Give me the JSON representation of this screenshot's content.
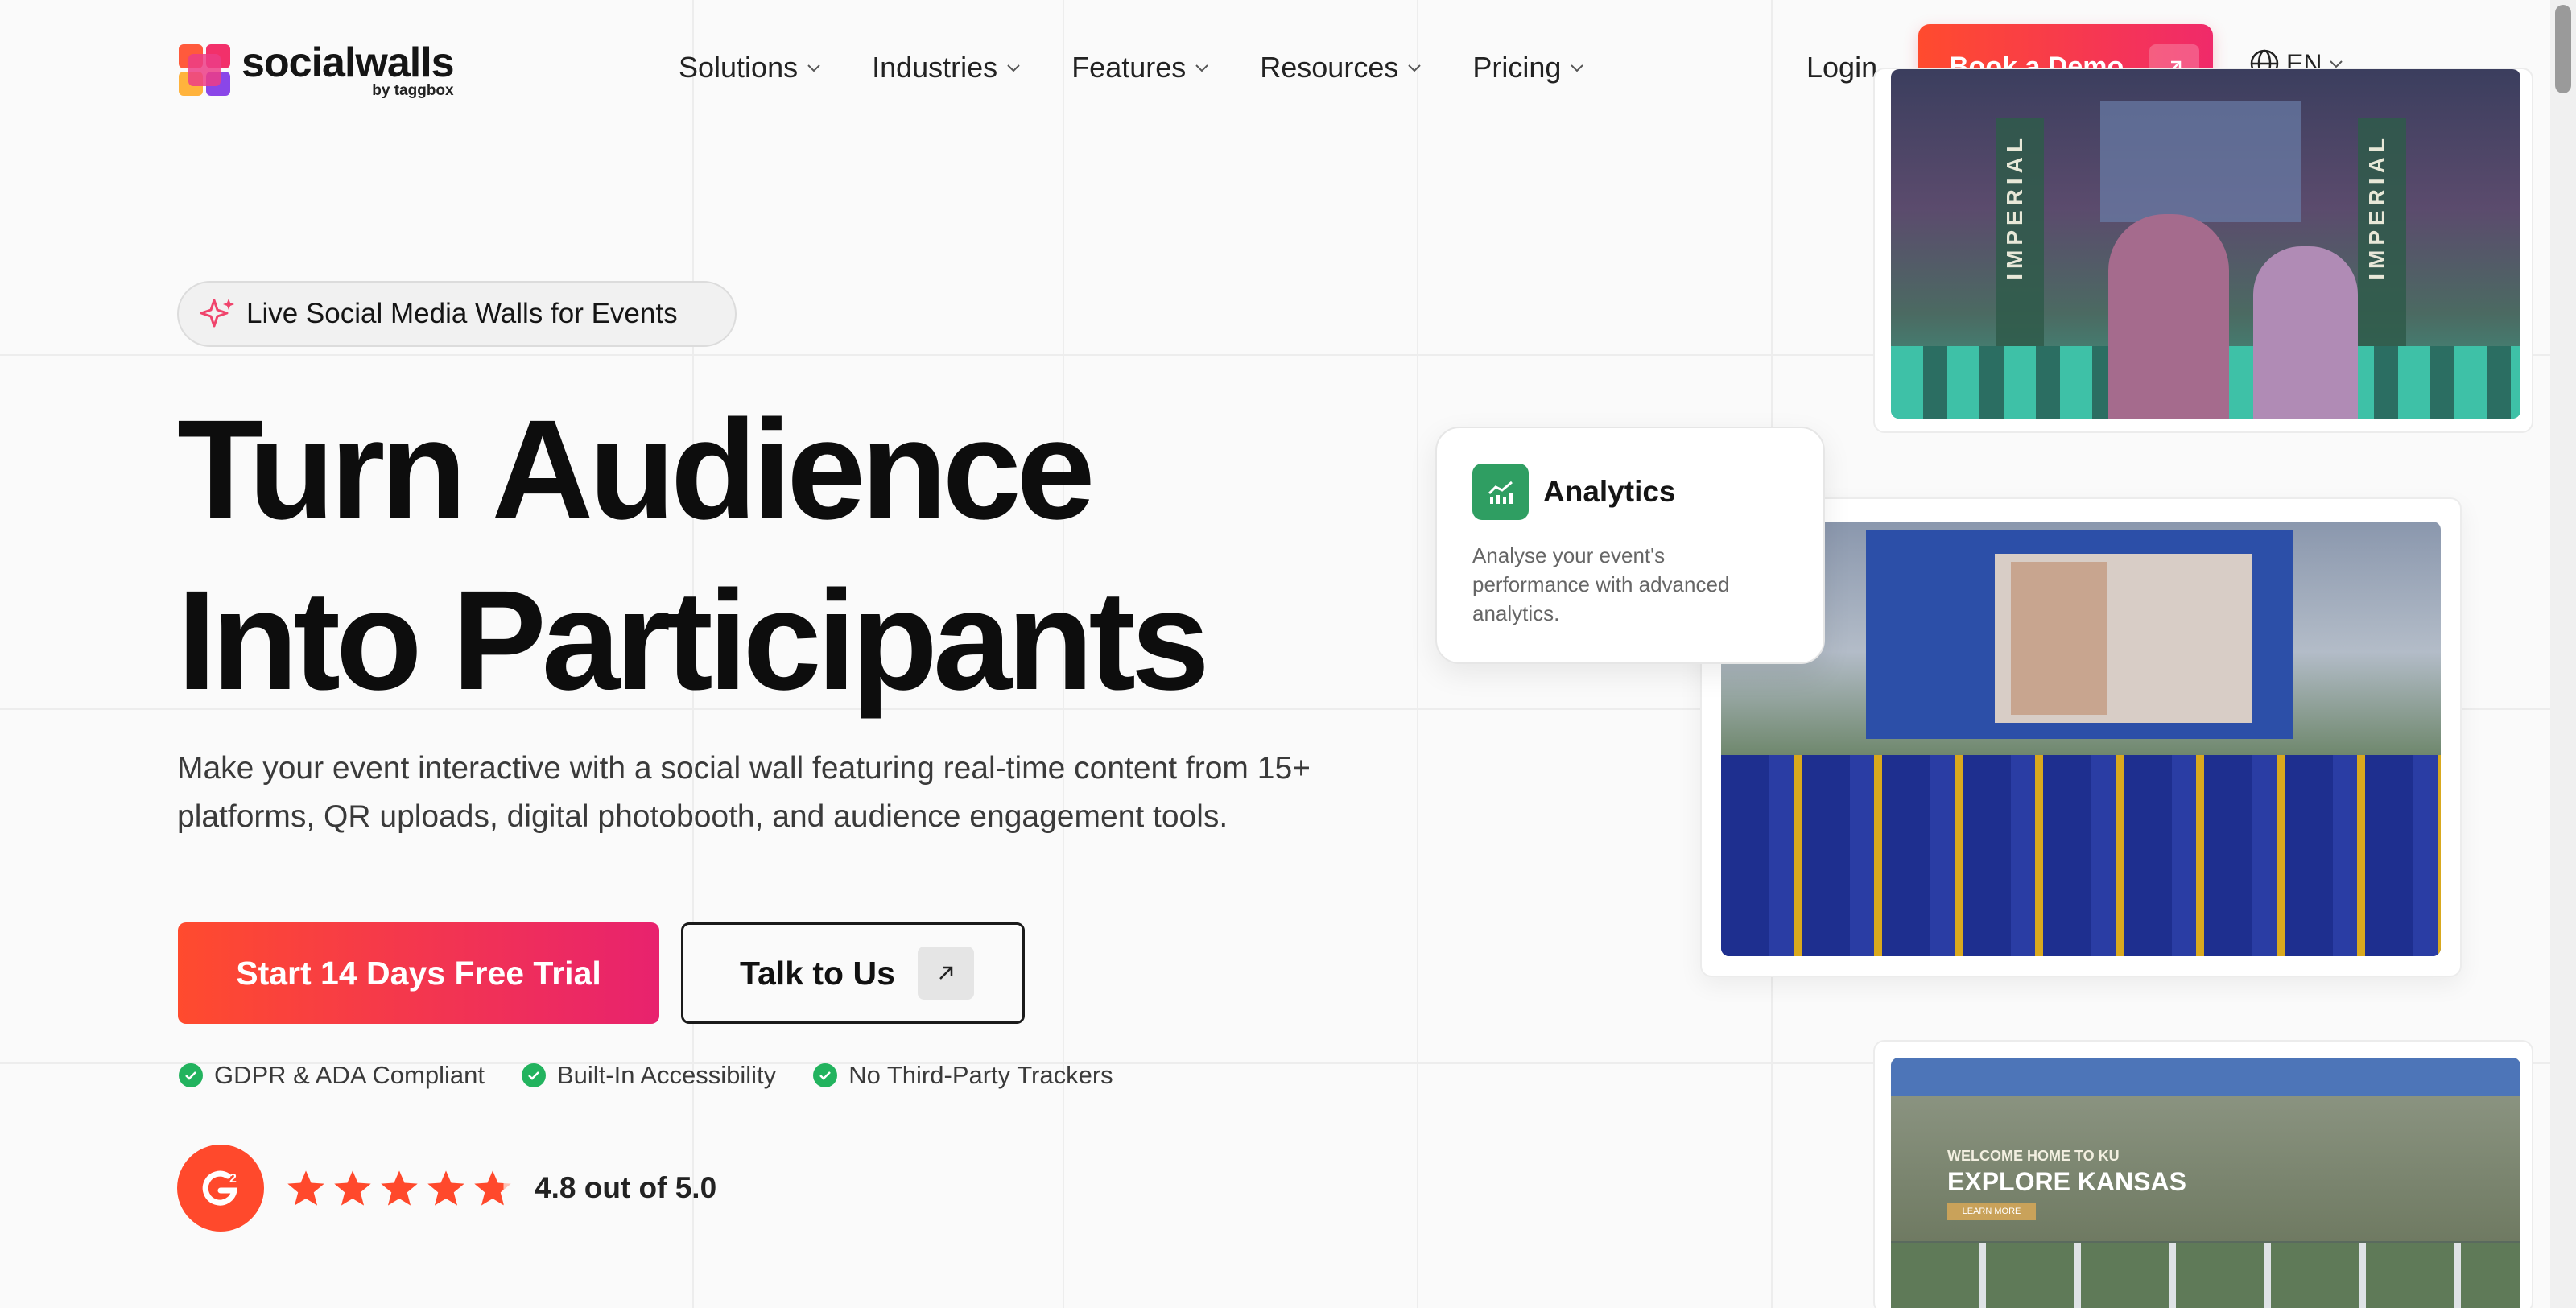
{
  "header": {
    "logo_word": "socialwalls",
    "logo_byline": "by taggbox",
    "nav": [
      {
        "label": "Solutions"
      },
      {
        "label": "Industries"
      },
      {
        "label": "Features"
      },
      {
        "label": "Resources"
      },
      {
        "label": "Pricing"
      }
    ],
    "login_label": "Login",
    "demo_label": "Book a Demo",
    "language": "EN"
  },
  "hero": {
    "badge": "Live Social Media Walls for Events",
    "headline_line1": "Turn Audience",
    "headline_line2": "Into Participants",
    "subtitle": "Make your event interactive with a social wall featuring real-time content from 15+ platforms, QR uploads, digital photobooth, and audience engagement tools.",
    "cta_primary": "Start 14 Days Free Trial",
    "cta_secondary": "Talk to Us",
    "trust": [
      {
        "label": "GDPR & ADA Compliant"
      },
      {
        "label": "Built-In Accessibility"
      },
      {
        "label": "No Third-Party Trackers"
      }
    ],
    "rating_text": "4.8 out of 5.0",
    "rating_value": 4.8,
    "rating_max": 5
  },
  "showcase": {
    "top_banner_left": "IMPERIAL",
    "top_banner_right": "IMPERIAL",
    "analytics_title": "Analytics",
    "analytics_desc": "Analyse your event's performance with advanced analytics.",
    "bottom_headline": "EXPLORE KANSAS",
    "bottom_welcome": "WELCOME HOME TO KU",
    "bottom_learn": "LEARN MORE"
  },
  "colors": {
    "brand_gradient_start": "#ff4b2e",
    "brand_gradient_end": "#e8226e",
    "check_green": "#22b35e",
    "analytics_green": "#2f9e62",
    "g2_red": "#ff492c"
  }
}
